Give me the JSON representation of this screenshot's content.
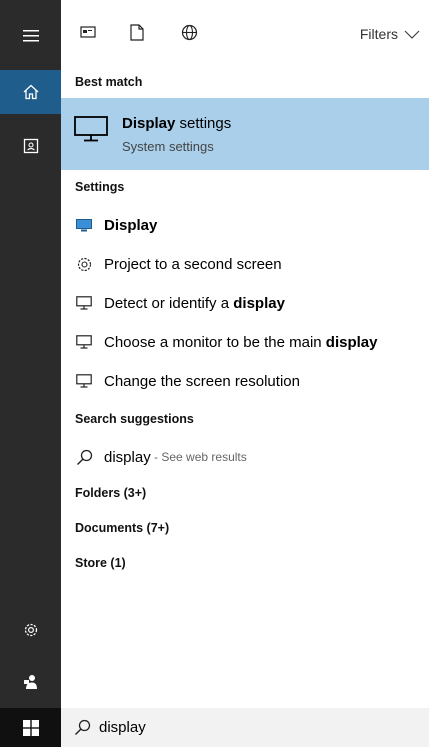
{
  "toolbar": {
    "filters_label": "Filters",
    "icons": [
      "apps-icon",
      "document-icon",
      "web-icon",
      "chevron-down-icon"
    ]
  },
  "sections": {
    "best_match": "Best match",
    "settings": "Settings",
    "search_suggestions": "Search suggestions",
    "folders": "Folders (3+)",
    "documents": "Documents (7+)",
    "store": "Store (1)"
  },
  "best_match": {
    "title_bold": "Display",
    "title_rest": " settings",
    "subtitle": "System settings",
    "icon": "monitor-icon"
  },
  "settings_items": [
    {
      "pre": "",
      "bold": "Display",
      "post": "",
      "icon": "display-color-icon"
    },
    {
      "pre": "Project to a second screen",
      "bold": "",
      "post": "",
      "icon": "gear-outline-icon"
    },
    {
      "pre": "Detect or identify a ",
      "bold": "display",
      "post": "",
      "icon": "monitor-icon"
    },
    {
      "pre": "Choose a monitor to be the main ",
      "bold": "display",
      "post": "",
      "icon": "monitor-icon"
    },
    {
      "pre": "Change the screen resolution",
      "bold": "",
      "post": "",
      "icon": "monitor-icon"
    }
  ],
  "suggestion": {
    "text": "display",
    "hint": " - See web results",
    "icon": "search-icon"
  },
  "rail": {
    "items": [
      "hamburger-icon",
      "home-icon",
      "notebook-icon",
      "settings-icon",
      "feedback-icon"
    ]
  },
  "search": {
    "value": "display",
    "icon": "search-icon"
  },
  "colors": {
    "rail_bg": "#2b2b2b",
    "rail_active": "#1f5d8c",
    "highlight": "#aacfeb",
    "taskbar": "#101010"
  }
}
